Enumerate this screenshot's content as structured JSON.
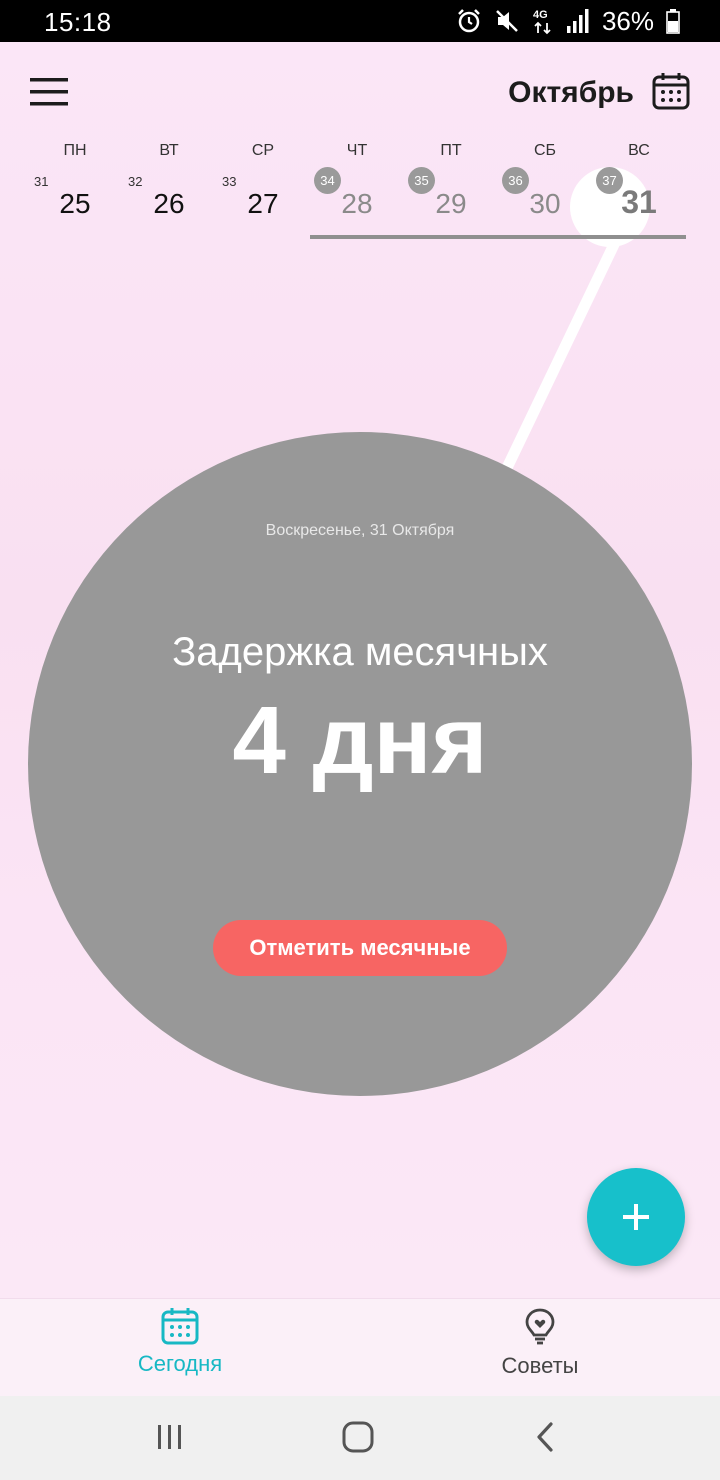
{
  "status_bar": {
    "time": "15:18",
    "network": "4G",
    "battery": "36%"
  },
  "header": {
    "month": "Октябрь"
  },
  "week": {
    "days": [
      {
        "name": "ПН",
        "week": "31",
        "date": "25"
      },
      {
        "name": "ВТ",
        "week": "32",
        "date": "26"
      },
      {
        "name": "СР",
        "week": "33",
        "date": "27"
      },
      {
        "name": "ЧТ",
        "week": "34",
        "date": "28"
      },
      {
        "name": "ПТ",
        "week": "35",
        "date": "29"
      },
      {
        "name": "СБ",
        "week": "36",
        "date": "30"
      },
      {
        "name": "ВС",
        "week": "37",
        "date": "31"
      }
    ],
    "selected_index": 6
  },
  "main": {
    "date_label": "Воскресенье, 31 Октября",
    "title": "Задержка месячных",
    "value": "4 дня",
    "button_label": "Отметить месячные"
  },
  "fab": {
    "icon": "plus-icon"
  },
  "bottom_nav": {
    "today_label": "Сегодня",
    "tips_label": "Советы"
  },
  "colors": {
    "accent": "#17c0cb",
    "button": "#f76563",
    "circle": "#989898",
    "background": "#f9e0f1"
  }
}
